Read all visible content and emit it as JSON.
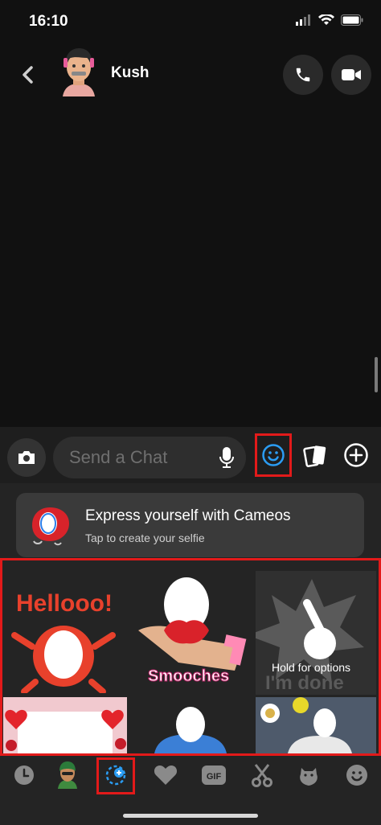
{
  "status_bar": {
    "time": "16:10"
  },
  "header": {
    "contact_name": "Kush",
    "back_icon": "chevron-left-icon",
    "call_icon": "phone-icon",
    "video_icon": "video-camera-icon"
  },
  "composer": {
    "placeholder": "Send a Chat",
    "camera_icon": "camera-icon",
    "mic_icon": "microphone-icon",
    "emoji_icon": "smiley-icon",
    "cards_icon": "cards-icon",
    "plus_icon": "plus-circle-icon",
    "accent_color": "#2b9df4"
  },
  "cameo_banner": {
    "title": "Express yourself with Cameos",
    "subtitle": "Tap to create your selfie"
  },
  "stickers": [
    {
      "text": "Hellooo!"
    },
    {
      "text": "Smooches"
    },
    {
      "overlay": "Hold for options",
      "text": "I'm done"
    },
    {
      "text": ""
    },
    {
      "text": ""
    },
    {
      "text": ""
    }
  ],
  "tabs": [
    {
      "icon": "clock-icon"
    },
    {
      "icon": "bitmoji-icon"
    },
    {
      "icon": "cameo-icon",
      "selected": true
    },
    {
      "icon": "heart-icon"
    },
    {
      "icon": "gif-icon",
      "label": "GIF"
    },
    {
      "icon": "scissors-icon"
    },
    {
      "icon": "animal-sticker-icon"
    },
    {
      "icon": "smiley-icon"
    }
  ],
  "highlight_color": "#e21a1a"
}
